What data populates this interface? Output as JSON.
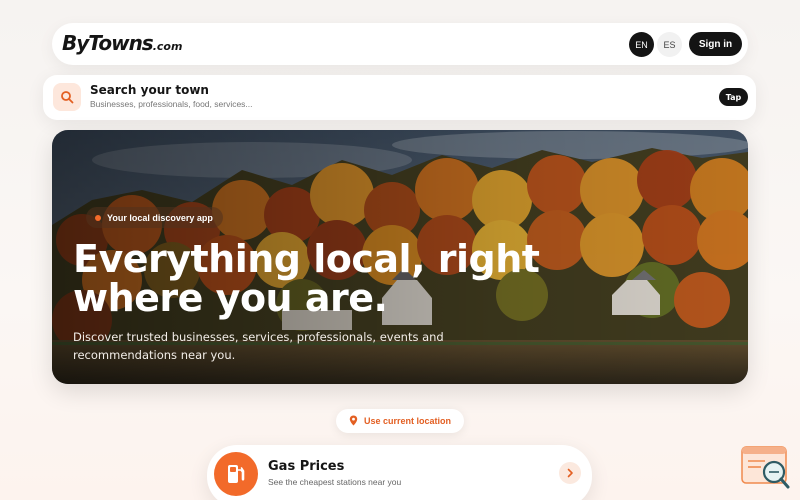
{
  "header": {
    "logo_main": "ByTowns",
    "logo_tld": ".com",
    "lang_en": "EN",
    "lang_es": "ES",
    "signin": "Sign in"
  },
  "search": {
    "icon": "search-icon",
    "title": "Search your town",
    "subtitle": "Businesses, professionals, food, services...",
    "tap": "Tap"
  },
  "hero": {
    "badge": "Your local discovery app",
    "headline_line1": "Everything local, right",
    "headline_line2": "where you are.",
    "description": "Discover trusted businesses, services, professionals, events and recommendations near you."
  },
  "location": {
    "icon": "map-pin-icon",
    "label": "Use current location"
  },
  "cards": [
    {
      "icon": "gas-pump-icon",
      "title": "Gas Prices",
      "subtitle": "See the cheapest stations near you"
    }
  ],
  "colors": {
    "accent": "#f26a2a",
    "dark": "#141414",
    "background": "#f8f4f1"
  }
}
